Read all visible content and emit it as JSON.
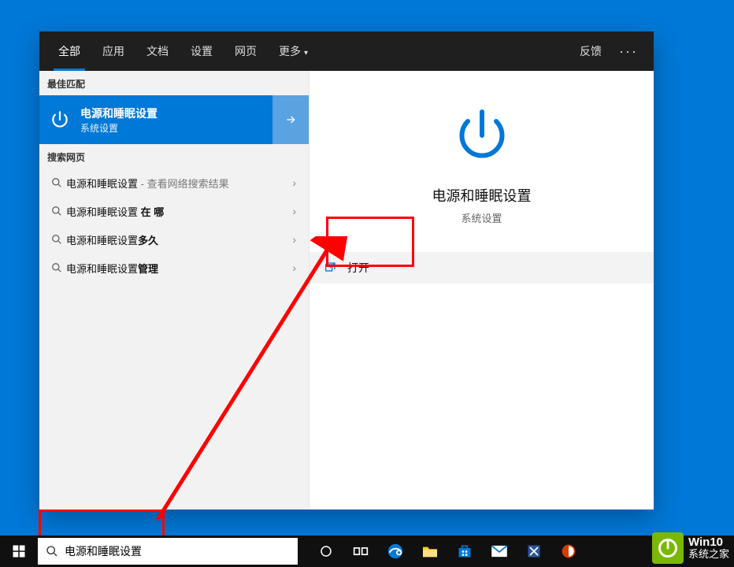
{
  "tabs": {
    "all": "全部",
    "apps": "应用",
    "docs": "文档",
    "settings": "设置",
    "web": "网页",
    "more": "更多"
  },
  "topbar": {
    "feedback": "反馈"
  },
  "sections": {
    "best_match": "最佳匹配",
    "search_web": "搜索网页"
  },
  "best_match": {
    "title": "电源和睡眠设置",
    "sub": "系统设置"
  },
  "web_results": [
    {
      "base": "电源和睡眠设置",
      "bold": "",
      "hint": " - 查看网络搜索结果"
    },
    {
      "base": "电源和睡眠设置 ",
      "bold": "在 哪",
      "hint": ""
    },
    {
      "base": "电源和睡眠设置",
      "bold": "多久",
      "hint": ""
    },
    {
      "base": "电源和睡眠设置",
      "bold": "管理",
      "hint": ""
    }
  ],
  "detail": {
    "title": "电源和睡眠设置",
    "sub": "系统设置",
    "action_open": "打开"
  },
  "search": {
    "value": "电源和睡眠设置"
  },
  "watermark": {
    "line1": "Win10",
    "line2": "系统之家"
  }
}
